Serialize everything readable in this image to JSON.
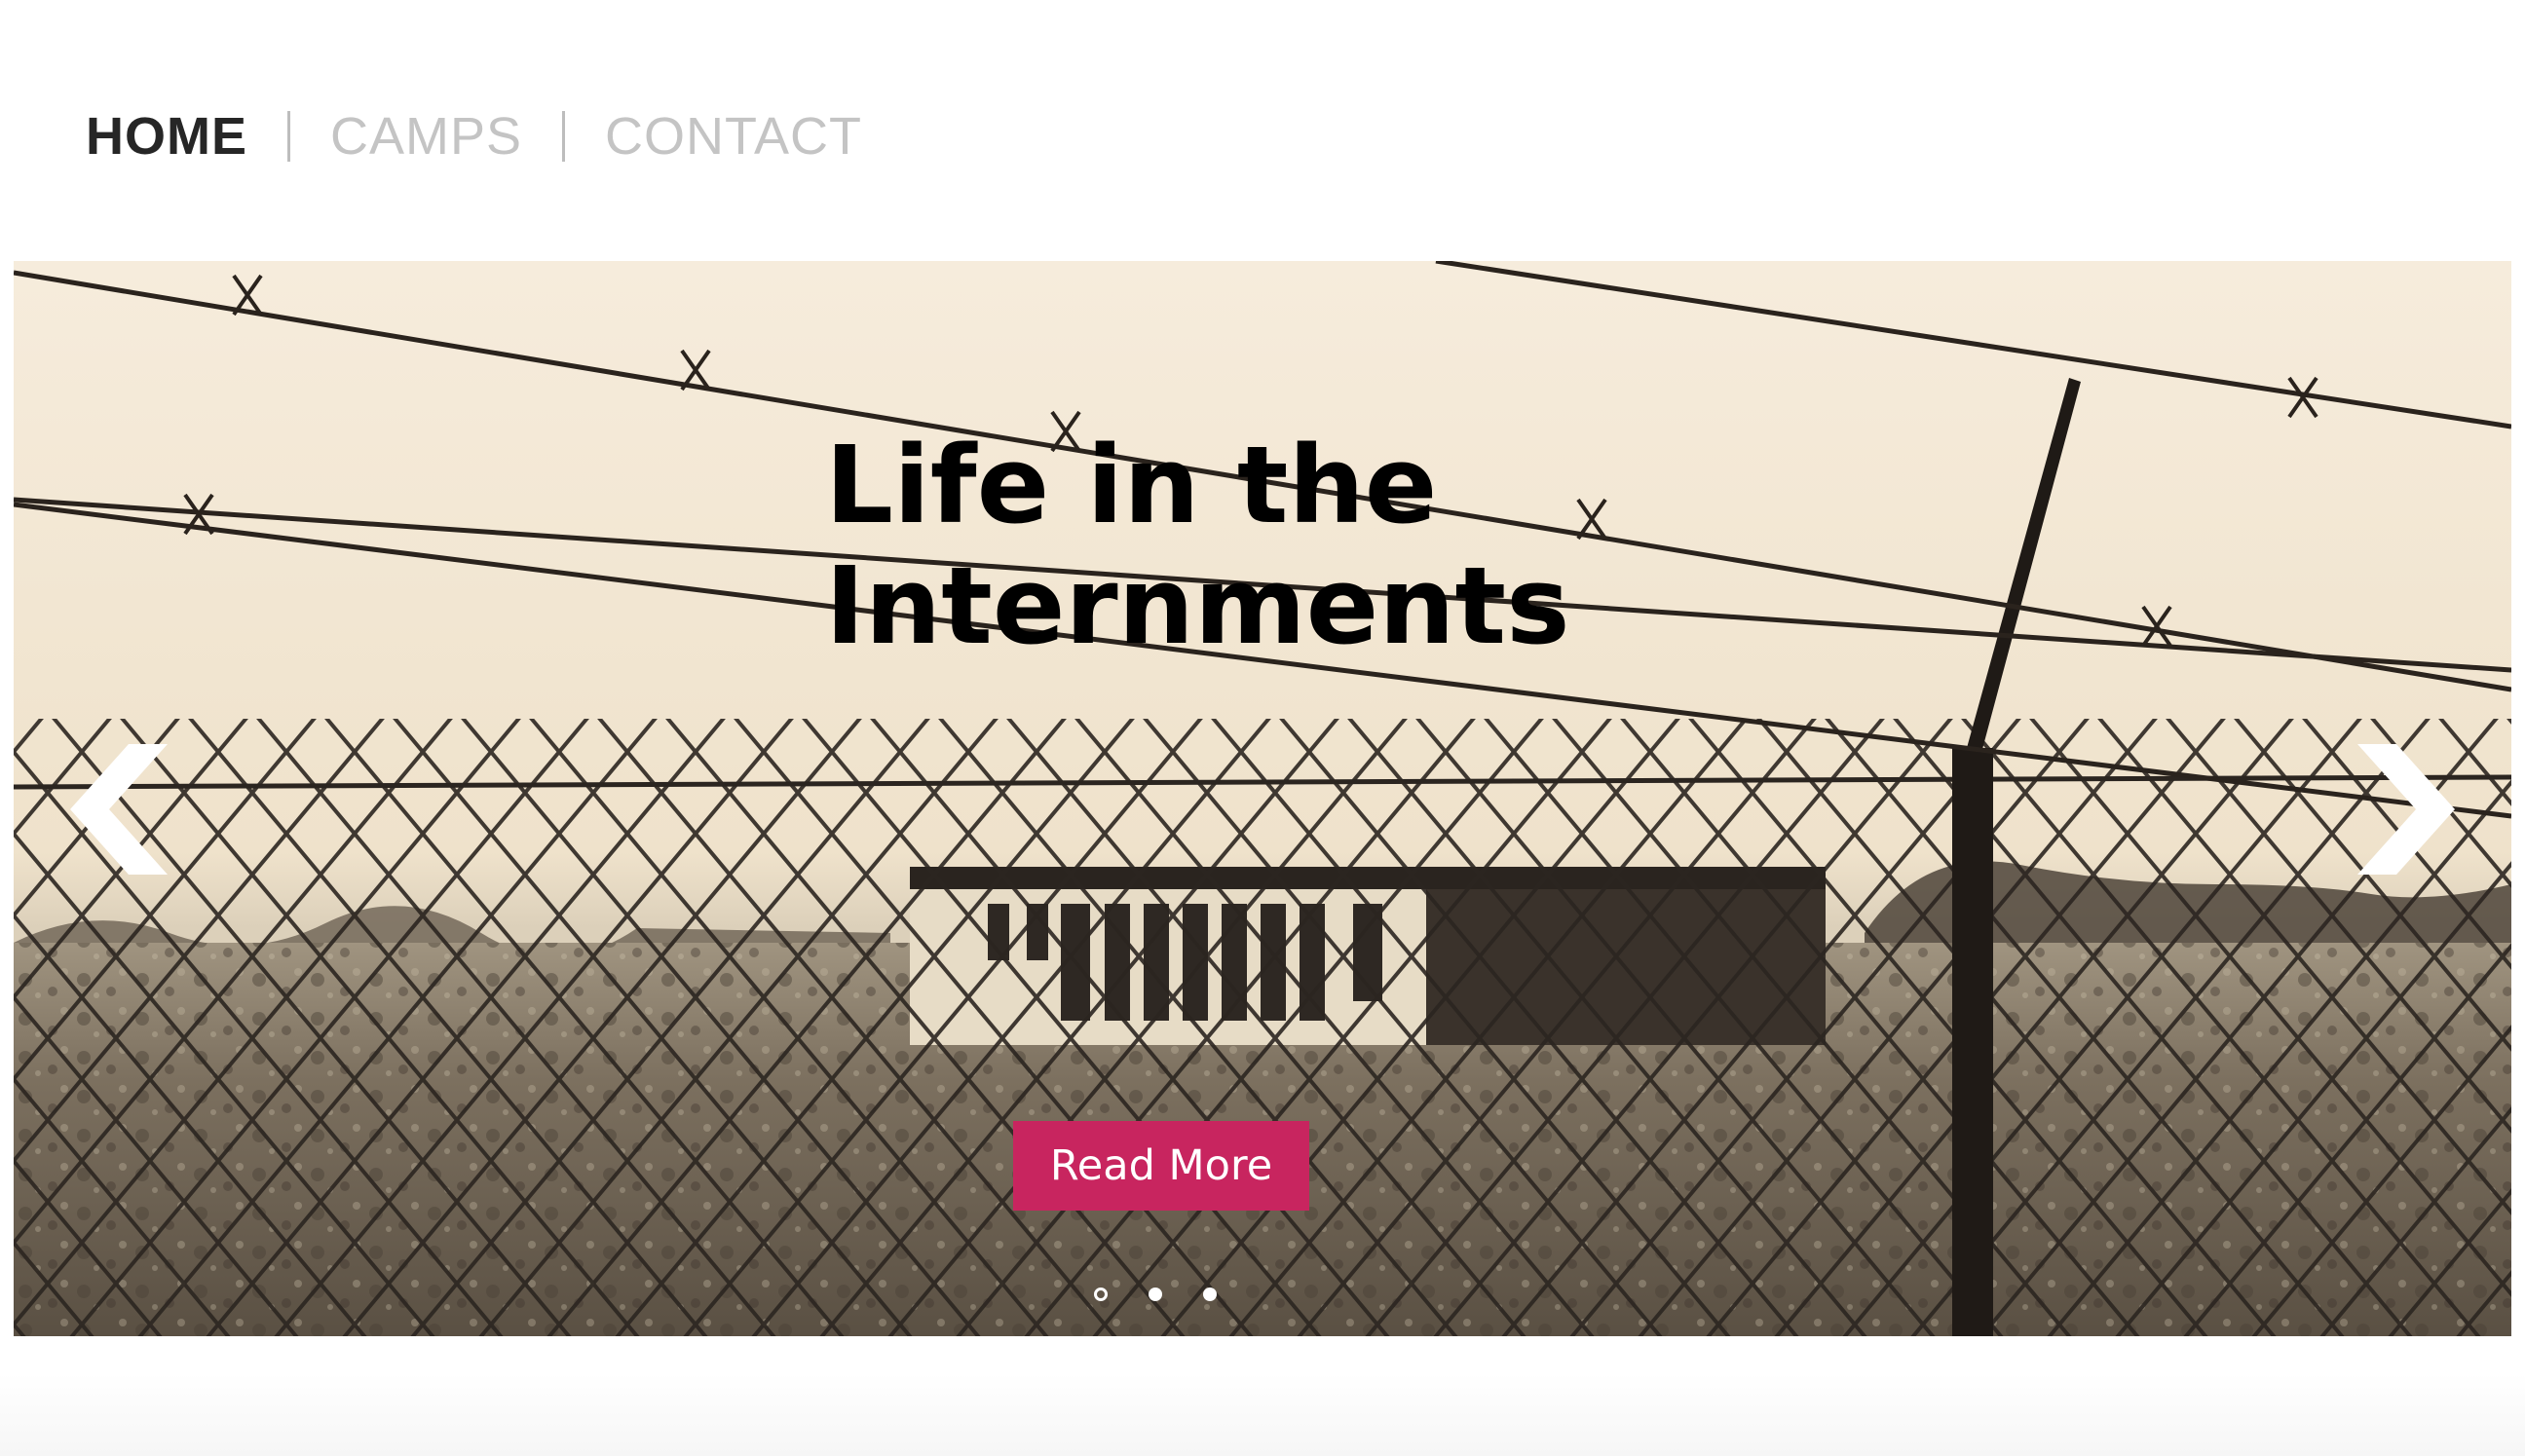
{
  "nav": {
    "items": [
      {
        "label": "HOME",
        "active": true
      },
      {
        "label": "CAMPS",
        "active": false
      },
      {
        "label": "CONTACT",
        "active": false
      }
    ]
  },
  "hero": {
    "title_line1": "Life in the",
    "title_line2": "Internments",
    "button_label": "Read More",
    "button_color": "#c8255f",
    "prev_icon": "chevron-left-icon",
    "next_icon": "chevron-right-icon",
    "slides": {
      "count": 3,
      "current_index": 0
    },
    "image_subject": "sepia photograph of a barbed-wire chain-link fence in front of an internment camp barrack"
  }
}
